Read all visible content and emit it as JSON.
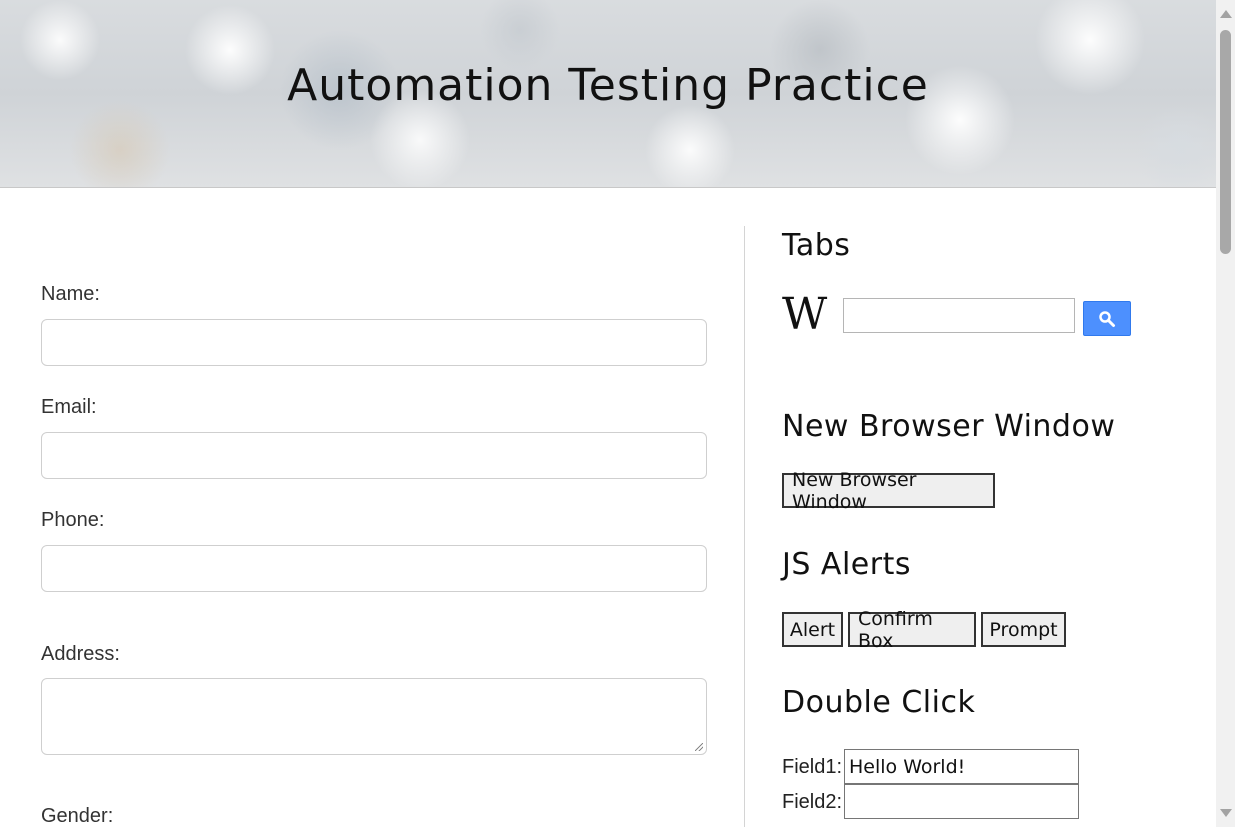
{
  "header": {
    "title": "Automation Testing Practice"
  },
  "form": {
    "name_label": "Name:",
    "email_label": "Email:",
    "phone_label": "Phone:",
    "address_label": "Address:",
    "gender_label": "Gender:",
    "name_value": "",
    "email_value": "",
    "phone_value": "",
    "address_value": ""
  },
  "tabs": {
    "title": "Tabs",
    "wiki_logo": "W",
    "search_value": "",
    "search_icon": "search-icon",
    "search_button_color": "#4d90fe"
  },
  "new_window": {
    "title": "New Browser Window",
    "button_label": "New Browser Window"
  },
  "js_alerts": {
    "title": "JS Alerts",
    "alert_label": "Alert",
    "confirm_label": "Confirm Box",
    "prompt_label": "Prompt"
  },
  "double_click": {
    "title": "Double Click",
    "field1_label": "Field1:",
    "field1_value": "Hello World!",
    "field2_label": "Field2:",
    "field2_value": ""
  }
}
